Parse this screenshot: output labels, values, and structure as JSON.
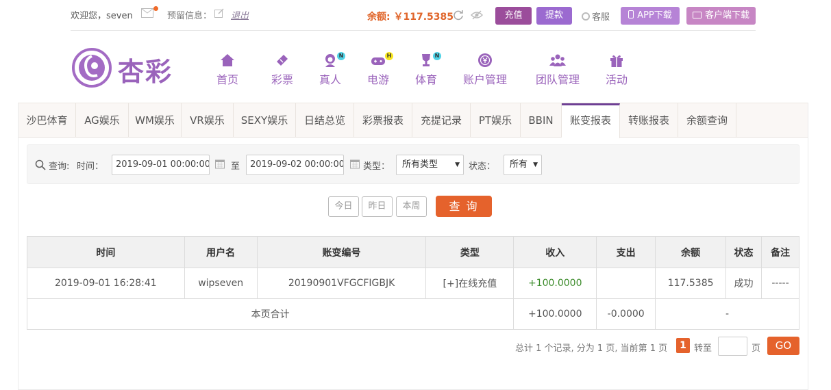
{
  "header": {
    "welcome_prefix": "欢迎您，",
    "username": "seven",
    "reserve_label": "预留信息：",
    "logout_label": "退出",
    "balance_label": "余额: ￥117.5385",
    "recharge_label": "充值",
    "withdraw_label": "提款",
    "service_label": "客服",
    "app_download_label": "APP下载",
    "client_download_label": "客户端下载"
  },
  "logo": {
    "text": "杏彩"
  },
  "nav": {
    "items": [
      {
        "label": "首页",
        "icon": "home-icon"
      },
      {
        "label": "彩票",
        "icon": "lottery-ticket-icon"
      },
      {
        "label": "真人",
        "icon": "live-dealer-icon",
        "badge": "N"
      },
      {
        "label": "电游",
        "icon": "gamepad-icon",
        "badge": "H"
      },
      {
        "label": "体育",
        "icon": "trophy-icon",
        "badge": "N"
      },
      {
        "label": "账户管理",
        "icon": "account-yen-icon"
      },
      {
        "label": "团队管理",
        "icon": "team-icon"
      },
      {
        "label": "活动",
        "icon": "gift-icon"
      }
    ]
  },
  "tabs": [
    "沙巴体育",
    "AG娱乐",
    "WM娱乐",
    "VR娱乐",
    "SEXY娱乐",
    "日结总览",
    "彩票报表",
    "充提记录",
    "PT娱乐",
    "BBIN",
    "账变报表",
    "转账报表",
    "余额查询"
  ],
  "active_tab": "账变报表",
  "filter": {
    "query_label": "查询:",
    "time_label": "时间：",
    "start_time": "2019-09-01 00:00:00",
    "to_label": "至",
    "end_time": "2019-09-02 00:00:00",
    "type_label": "类型：",
    "type_value": "所有类型",
    "status_label": "状态：",
    "status_value": "所有"
  },
  "quick_buttons": {
    "today": "今日",
    "yesterday": "昨日",
    "this_week": "本周",
    "query": "查 询"
  },
  "table": {
    "headers": [
      "时间",
      "用户名",
      "账变编号",
      "类型",
      "收入",
      "支出",
      "余额",
      "状态",
      "备注"
    ],
    "rows": [
      [
        "2019-09-01 16:28:41",
        "wipseven",
        "20190901VFGCFIGBJK",
        "[+]在线充值",
        "+100.0000",
        "",
        "117.5385",
        "成功",
        "-----"
      ]
    ],
    "summary": {
      "label": "本页合计",
      "income": "+100.0000",
      "expense": "-0.0000",
      "balance": "-"
    }
  },
  "pager": {
    "summary": "总计 1 个记录, 分为 1 页, 当前第 1 页",
    "current_page": "1",
    "goto_label": "转至",
    "page_unit": "页",
    "go_label": "GO"
  },
  "colors": {
    "brand_purple": "#9a63bb",
    "accent_orange": "#e5622c",
    "income_green": "#3d8c2c"
  }
}
